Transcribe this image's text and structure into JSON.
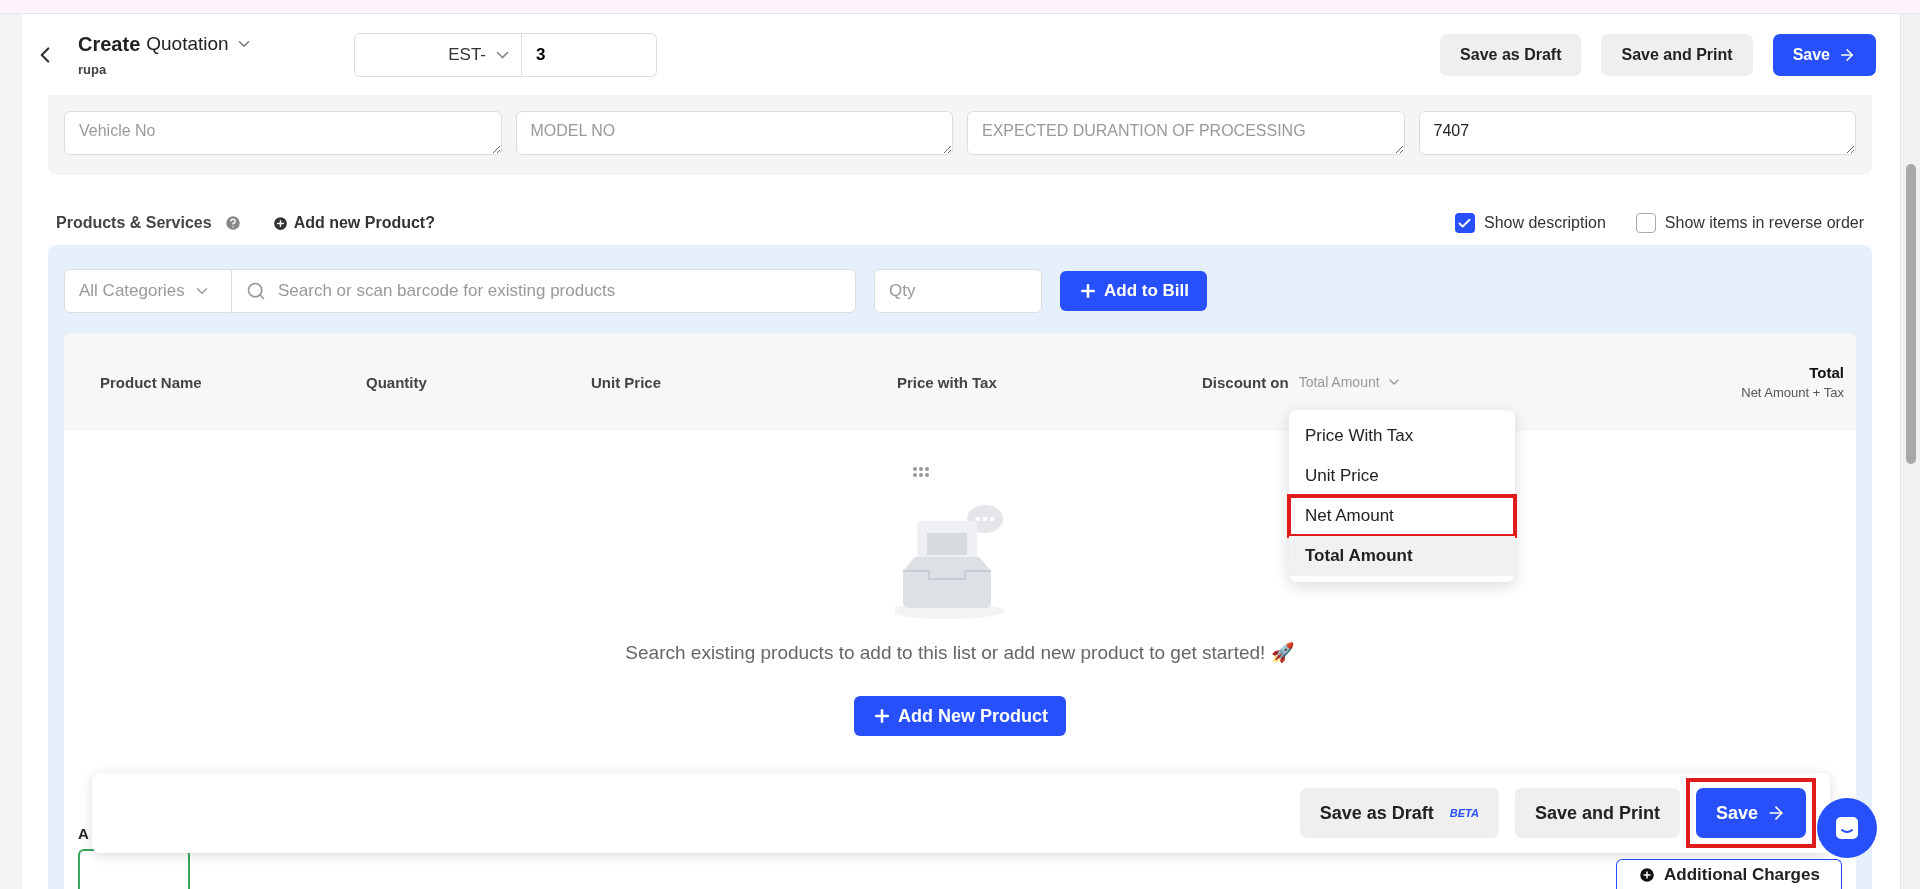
{
  "header": {
    "title": "Create",
    "doc_type": "Quotation",
    "subtitle": "rupa",
    "prefix": "EST-",
    "number": "3",
    "buttons": [
      {
        "label": "Save as Draft",
        "kind": "secondary"
      },
      {
        "label": "Save and Print",
        "kind": "secondary"
      },
      {
        "label": "Save",
        "kind": "primary"
      }
    ]
  },
  "fields": [
    {
      "placeholder": "Vehicle No"
    },
    {
      "placeholder": "MODEL NO"
    },
    {
      "placeholder": "EXPECTED DURANTION OF PROCESSING"
    },
    {
      "value": "7407"
    }
  ],
  "products": {
    "title": "Products & Services",
    "add_link": "Add new Product?",
    "options": [
      {
        "label": "Show description",
        "checked": true
      },
      {
        "label": "Show items in reverse order",
        "checked": false
      }
    ],
    "category": "All Categories",
    "search_placeholder": "Search or scan barcode for existing products",
    "qty_placeholder": "Qty",
    "add_button": "Add to Bill"
  },
  "table": {
    "columns": [
      "Product Name",
      "Quantity",
      "Unit Price",
      "Price with Tax"
    ],
    "discount_label": "Discount on",
    "discount_value": "Total Amount",
    "total": "Total",
    "total_sub": "Net Amount + Tax"
  },
  "discount_menu": [
    {
      "label": "Price With Tax",
      "selected": false,
      "highlighted": false
    },
    {
      "label": "Unit Price",
      "selected": false,
      "highlighted": false
    },
    {
      "label": "Net Amount",
      "selected": false,
      "highlighted": true
    },
    {
      "label": "Total Amount",
      "selected": true,
      "highlighted": false
    }
  ],
  "empty": {
    "message": "Search existing products to add to this list or add new product to get started! 🚀",
    "button": "Add New Product"
  },
  "footer": {
    "buttons": [
      {
        "label": "Save as Draft",
        "badge": "BETA",
        "kind": "secondary",
        "highlighted": false
      },
      {
        "label": "Save and Print",
        "kind": "secondary",
        "highlighted": false
      },
      {
        "label": "Save",
        "kind": "primary",
        "highlighted": true
      }
    ]
  },
  "below": {
    "cut_label": "A",
    "charges_button": "Additional Charges"
  }
}
